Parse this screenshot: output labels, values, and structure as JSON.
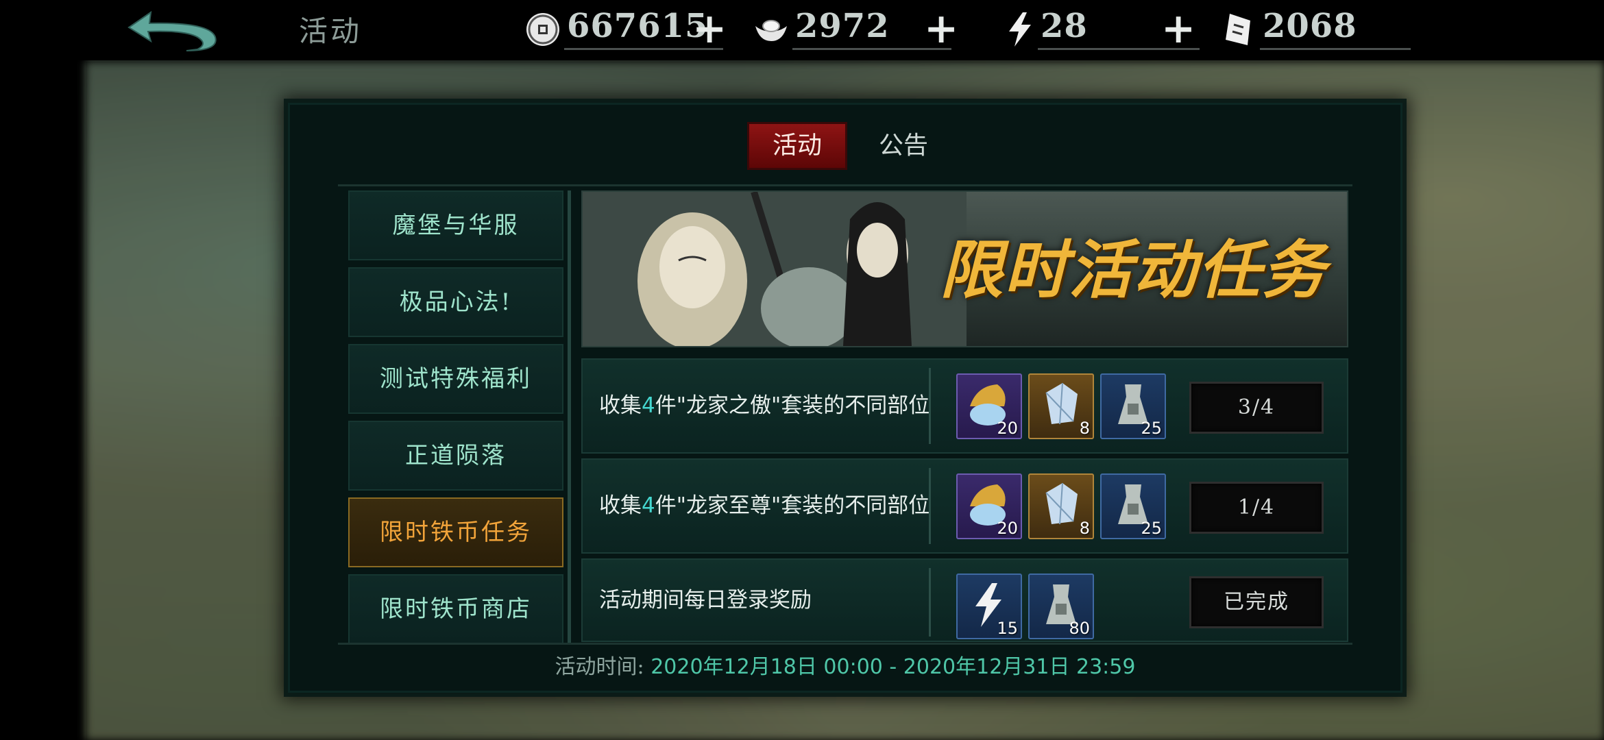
{
  "header": {
    "title": "活动",
    "resources": [
      {
        "icon": "coin-icon",
        "value": "667615"
      },
      {
        "icon": "silver-ingot-icon",
        "value": "2972"
      },
      {
        "icon": "lightning-icon",
        "value": "28"
      },
      {
        "icon": "ticket-icon",
        "value": "2068"
      }
    ],
    "plus_label": "+"
  },
  "tabs": [
    "活动",
    "公告"
  ],
  "sidebar": {
    "items": [
      "魔堡与华服",
      "极品心法!",
      "测试特殊福利",
      "正道陨落",
      "限时铁币任务",
      "限时铁币商店"
    ],
    "active_index": 4
  },
  "banner": {
    "title": "限时活动任务"
  },
  "tasks": [
    {
      "desc_prefix": "收集",
      "desc_num": "4",
      "desc_suffix": "件\"龙家之傲\"套装的不同部位",
      "rewards": [
        {
          "icon": "gold-treasure-icon",
          "count": "20"
        },
        {
          "icon": "crystal-icon",
          "count": "8"
        },
        {
          "icon": "iron-coin-icon",
          "count": "25"
        }
      ],
      "status": "3/4"
    },
    {
      "desc_prefix": "收集",
      "desc_num": "4",
      "desc_suffix": "件\"龙家至尊\"套装的不同部位",
      "rewards": [
        {
          "icon": "gold-treasure-icon",
          "count": "20"
        },
        {
          "icon": "crystal-icon",
          "count": "8"
        },
        {
          "icon": "iron-coin-icon",
          "count": "25"
        }
      ],
      "status": "1/4"
    },
    {
      "desc": "活动期间每日登录奖励",
      "rewards": [
        {
          "icon": "lightning-icon",
          "count": "15"
        },
        {
          "icon": "iron-coin-icon",
          "count": "80"
        }
      ],
      "status": "已完成"
    }
  ],
  "event_time": {
    "label": "活动时间:",
    "range": "2020年12月18日 00:00 - 2020年12月31日 23:59"
  }
}
